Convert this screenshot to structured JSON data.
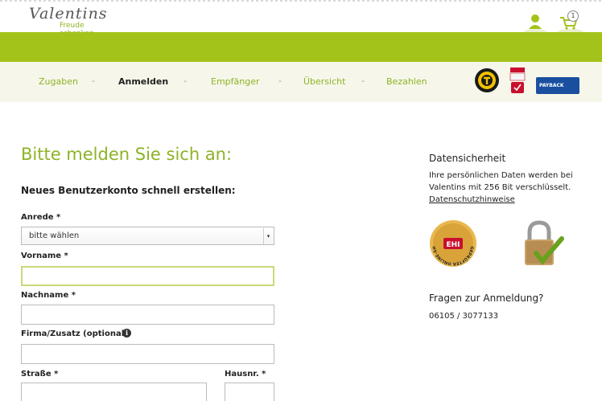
{
  "header": {
    "logo_script": "Valentins",
    "logo_tagline": "Freude schenken",
    "cart_count": "1"
  },
  "steps": [
    {
      "label": "Zugaben",
      "active": false
    },
    {
      "label": "Anmelden",
      "active": true
    },
    {
      "label": "Empfänger",
      "active": false
    },
    {
      "label": "Übersicht",
      "active": false
    },
    {
      "label": "Bezahlen",
      "active": false
    }
  ],
  "step_separator": "-",
  "badges": {
    "payback_label": "PAYBACK"
  },
  "form": {
    "title": "Bitte melden Sie sich an:",
    "subtitle": "Neues Benutzerkonto schnell erstellen:",
    "anrede_label": "Anrede *",
    "anrede_value": "bitte wählen",
    "vorname_label": "Vorname *",
    "vorname_value": "",
    "nachname_label": "Nachname *",
    "nachname_value": "",
    "firma_label": "Firma/Zusatz (optional)",
    "firma_value": "",
    "strasse_label": "Straße *",
    "strasse_value": "",
    "hausnr_label": "Hausnr. *",
    "hausnr_value": ""
  },
  "sidebar": {
    "security_title": "Datensicherheit",
    "security_text_1": "Ihre persönlichen Daten werden bei",
    "security_text_2": "Valentins mit 256 Bit verschlüsselt.",
    "privacy_link": "Datenschutzhinweise",
    "ehi_text": "GEPRÜFTER ONLINE-SHOP",
    "questions_title": "Fragen zur Anmeldung?",
    "phone": "06105 / 3077133"
  },
  "colors": {
    "brand_green": "#a4c31a",
    "step_bg": "#f6f7ea",
    "text_green": "#8db327"
  }
}
